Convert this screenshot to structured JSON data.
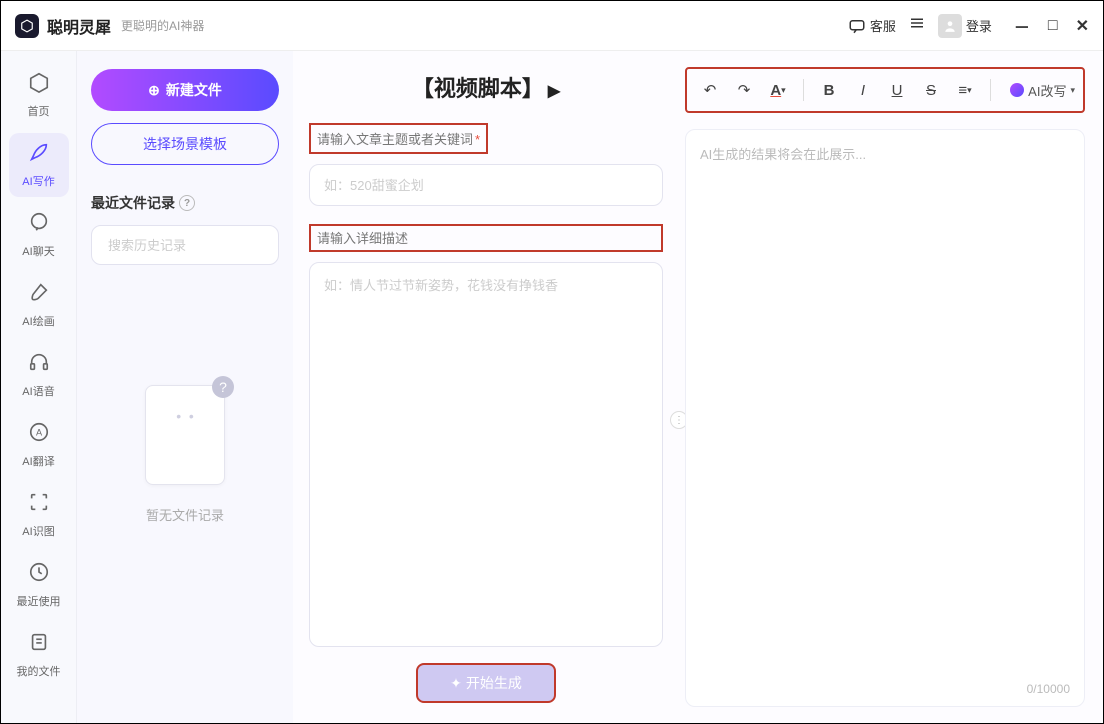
{
  "app": {
    "name": "聪明灵犀",
    "tagline": "更聪明的AI神器"
  },
  "titlebar": {
    "kefu": "客服",
    "login": "登录"
  },
  "rail": [
    {
      "label": "首页"
    },
    {
      "label": "AI写作"
    },
    {
      "label": "AI聊天"
    },
    {
      "label": "AI绘画"
    },
    {
      "label": "AI语音"
    },
    {
      "label": "AI翻译"
    },
    {
      "label": "AI识图"
    },
    {
      "label": "最近使用"
    },
    {
      "label": "我的文件"
    }
  ],
  "filepanel": {
    "new": "新建文件",
    "template": "选择场景模板",
    "recent": "最近文件记录",
    "search_ph": "搜索历史记录",
    "empty": "暂无文件记录"
  },
  "center": {
    "title": "【视频脚本】",
    "label_topic": "请输入文章主题或者关键词",
    "topic_ph": "如：520甜蜜企划",
    "label_detail": "请输入详细描述",
    "detail_ph": "如：情人节过节新姿势，花钱没有挣钱香",
    "generate": "开始生成"
  },
  "right": {
    "ai_rewrite": "AI改写",
    "placeholder": "AI生成的结果将会在此展示...",
    "counter": "0/10000"
  }
}
